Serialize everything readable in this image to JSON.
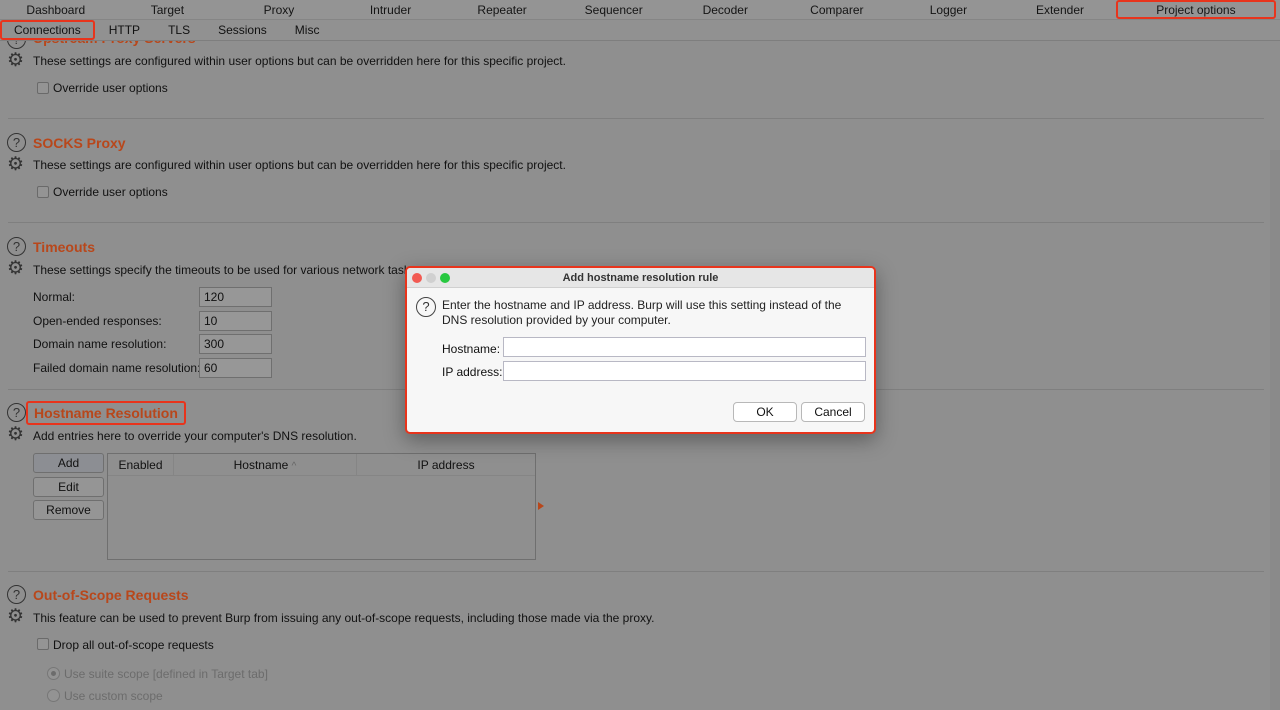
{
  "top_tabs": [
    "Dashboard",
    "Target",
    "Proxy",
    "Intruder",
    "Repeater",
    "Sequencer",
    "Decoder",
    "Comparer",
    "Logger",
    "Extender",
    "Project options"
  ],
  "top_tab_selected": "Project options",
  "sub_tabs": [
    "Connections",
    "HTTP",
    "TLS",
    "Sessions",
    "Misc"
  ],
  "sub_tab_selected": "Connections",
  "colors": {
    "accent": "#e8341c",
    "heading": "#b8471b"
  },
  "upstream": {
    "title": "Upstream Proxy Servers",
    "desc": "These settings are configured within user options but can be overridden here for this specific project.",
    "override": "Override user options"
  },
  "socks": {
    "title": "SOCKS Proxy",
    "desc": "These settings are configured within user options but can be overridden here for this specific project.",
    "override": "Override user options"
  },
  "timeouts": {
    "title": "Timeouts",
    "desc": "These settings specify the timeouts to be used for various network tasks.",
    "fields": [
      {
        "label": "Normal:",
        "value": "120"
      },
      {
        "label": "Open-ended responses:",
        "value": "10"
      },
      {
        "label": "Domain name resolution:",
        "value": "300"
      },
      {
        "label": "Failed domain name resolution:",
        "value": "60"
      }
    ]
  },
  "hostname": {
    "title": "Hostname Resolution",
    "desc": "Add entries here to override your computer's DNS resolution.",
    "buttons": {
      "add": "Add",
      "edit": "Edit",
      "remove": "Remove"
    },
    "columns": [
      "Enabled",
      "Hostname",
      "IP address"
    ],
    "sort_icon": "^"
  },
  "scope": {
    "title": "Out-of-Scope Requests",
    "desc": "This feature can be used to prevent Burp from issuing any out-of-scope requests, including those made via the proxy.",
    "drop": "Drop all out-of-scope requests",
    "radio1": "Use suite scope [defined in Target tab]",
    "radio2": "Use custom scope"
  },
  "dialog": {
    "title": "Add hostname resolution rule",
    "message": "Enter the hostname and IP address. Burp will use this setting instead of the DNS resolution provided by your computer.",
    "hostname_label": "Hostname:",
    "hostname_value": "",
    "ip_label": "IP address:",
    "ip_value": "",
    "ok": "OK",
    "cancel": "Cancel"
  }
}
